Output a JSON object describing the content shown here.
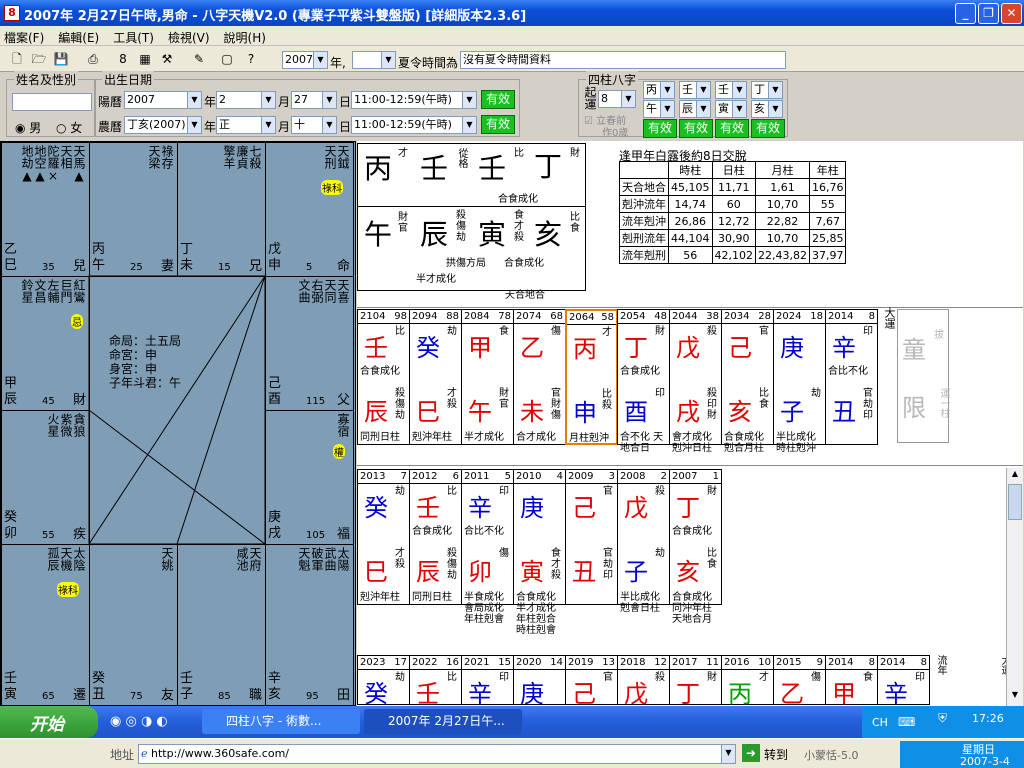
{
  "window": {
    "title": "2007年 2月27日午時,男命 - 八字天機V2.0 (專業子平紫斗雙盤版) [詳細版本2.3.6]"
  },
  "menu": [
    "檔案(F)",
    "編輯(E)",
    "工具(T)",
    "檢視(V)",
    "說明(H)"
  ],
  "toolbar": {
    "year": "2007",
    "year_unit": "年,",
    "dst_label": "夏令時間為",
    "dst_value": "沒有夏令時間資料"
  },
  "form": {
    "name_group": "姓名及性別",
    "birth_group": "出生日期",
    "male": "男",
    "female": "女",
    "solar_label": "陽曆",
    "solar_year": "2007",
    "solar_month": "2",
    "solar_day": "27",
    "solar_time": "11:00-12:59(午時)",
    "lunar_label": "農曆",
    "lunar_year": "丁亥(2007)",
    "lunar_month": "正",
    "lunar_day": "十",
    "lunar_time": "11:00-12:59(午時)",
    "valid": "有效",
    "year_u": "年",
    "month_u": "月",
    "day_u": "日"
  },
  "pillars_form": {
    "title": "四柱八字",
    "qiyun": "起運",
    "qiyun_val": "8",
    "sel": [
      [
        "丙",
        "壬",
        "壬",
        "丁"
      ],
      [
        "午",
        "辰",
        "寅",
        "亥"
      ]
    ],
    "valid": "有效",
    "lichun": "立春前",
    "zuo": "作0歲"
  },
  "ziwei": {
    "palaces": [
      {
        "stars": [
          "天馬▲",
          "天相",
          "陀羅×",
          "地空▲",
          "地劫▲"
        ],
        "gz": "乙巳",
        "num": "35",
        "name": "兒"
      },
      {
        "stars": [
          "祿存",
          "天梁"
        ],
        "gz": "丙午",
        "num": "25",
        "name": "妻"
      },
      {
        "stars": [
          "七殺",
          "廉貞",
          "擎羊"
        ],
        "gz": "丁未",
        "num": "15",
        "name": "兄"
      },
      {
        "stars": [
          "天鉞",
          "天刑"
        ],
        "gz": "戊申",
        "num": "5",
        "name": "命"
      },
      {
        "stars": [
          "紅鸞",
          "巨門",
          "左輔",
          "文昌",
          "鈴星"
        ],
        "gz": "甲辰",
        "num": "45",
        "name": "財"
      },
      {
        "stars": [
          "天喜",
          "天同",
          "右弼",
          "文曲"
        ],
        "gz": "己酉",
        "num": "115",
        "name": "父"
      },
      {
        "stars": [
          "貪狼",
          "紫微",
          "火星"
        ],
        "gz": "癸卯",
        "num": "55",
        "name": "疾"
      },
      {
        "stars": [
          "寡宿"
        ],
        "gz": "庚戌",
        "num": "105",
        "name": "福"
      },
      {
        "stars": [
          "太陰",
          "天機",
          "孤辰"
        ],
        "gz": "壬寅",
        "num": "65",
        "name": "遷"
      },
      {
        "stars": [
          "天姚"
        ],
        "gz": "癸丑",
        "num": "75",
        "name": "友"
      },
      {
        "stars": [
          "天府",
          "咸池"
        ],
        "gz": "壬子",
        "num": "85",
        "name": "職"
      },
      {
        "stars": [
          "太陽",
          "武曲",
          "破軍",
          "天魁"
        ],
        "gz": "辛亥",
        "num": "95",
        "name": "田"
      }
    ],
    "center": [
      "命局：土五局",
      "命宮：申",
      "身宮：申",
      "子年斗君：午"
    ],
    "badges": {
      "lu": "祿科",
      "ji": "忌",
      "ke": "權",
      "lu2": "祿科"
    }
  },
  "bazi": {
    "stems": [
      "丙",
      "壬",
      "壬",
      "丁"
    ],
    "branches": [
      "午",
      "辰",
      "寅",
      "亥"
    ],
    "stem_tags": [
      "才",
      "從格",
      "比",
      "財"
    ],
    "branch_tags": [
      "財官",
      "殺傷劫",
      "食才殺",
      "比食"
    ],
    "notes": [
      "合食成化",
      "拱傷方局",
      "合食成化",
      "半才成化",
      "天合地合"
    ],
    "yun_note": "逢甲年白露後約8日交脫",
    "table": {
      "head": [
        "",
        "時柱",
        "日柱",
        "月柱",
        "年柱"
      ],
      "rows": [
        [
          "天合地合",
          "45,105",
          "11,71",
          "1,61",
          "16,76"
        ],
        [
          "剋沖流年",
          "14,74",
          "60",
          "10,70",
          "55"
        ],
        [
          "流年剋沖",
          "26,86",
          "12,72",
          "22,82",
          "7,67"
        ],
        [
          "剋刑流年",
          "44,104",
          "30,90",
          "10,70",
          "25,85"
        ],
        [
          "流年剋刑",
          "56",
          "42,102",
          "22,43,82",
          "37,97"
        ]
      ]
    }
  },
  "dayun": [
    {
      "y": "2104",
      "a": "98",
      "s": "壬",
      "st": "比",
      "b": "辰",
      "bt": "殺傷劫",
      "n1": "合食成化",
      "n2": "同刑日柱",
      "sc": "red",
      "bc": "red"
    },
    {
      "y": "2094",
      "a": "88",
      "s": "癸",
      "st": "劫",
      "b": "巳",
      "bt": "才殺",
      "n1": "",
      "n2": "剋沖年柱",
      "sc": "blue",
      "bc": "red"
    },
    {
      "y": "2084",
      "a": "78",
      "s": "甲",
      "st": "食",
      "b": "午",
      "bt": "財官",
      "n1": "",
      "n2": "半才成化",
      "sc": "red",
      "bc": "red"
    },
    {
      "y": "2074",
      "a": "68",
      "s": "乙",
      "st": "傷",
      "b": "未",
      "bt": "官財傷",
      "n1": "",
      "n2": "合才成化",
      "sc": "red",
      "bc": "red"
    },
    {
      "y": "2064",
      "a": "58",
      "s": "丙",
      "st": "才",
      "b": "申",
      "bt": "比殺",
      "n1": "",
      "n2": "月柱剋沖",
      "sc": "red",
      "bc": "blue"
    },
    {
      "y": "2054",
      "a": "48",
      "s": "丁",
      "st": "財",
      "b": "酉",
      "bt": "印",
      "n1": "合食成化",
      "n2": "合不化 天地合日",
      "sc": "red",
      "bc": "blue"
    },
    {
      "y": "2044",
      "a": "38",
      "s": "戊",
      "st": "殺",
      "b": "戌",
      "bt": "殺印財",
      "n1": "",
      "n2": "會才成化 剋沖日柱",
      "sc": "red",
      "bc": "red"
    },
    {
      "y": "2034",
      "a": "28",
      "s": "己",
      "st": "官",
      "b": "亥",
      "bt": "比食",
      "n1": "",
      "n2": "合食成化 剋合月柱",
      "sc": "red",
      "bc": "red"
    },
    {
      "y": "2024",
      "a": "18",
      "s": "庚",
      "st": "",
      "b": "子",
      "bt": "劫",
      "n1": "",
      "n2": "半比成化 時柱剋沖",
      "sc": "blue",
      "bc": "blue"
    },
    {
      "y": "2014",
      "a": "8",
      "s": "辛",
      "st": "印",
      "b": "丑",
      "bt": "官劫印",
      "n1": "合比不化",
      "n2": "",
      "sc": "blue",
      "bc": "blue"
    }
  ],
  "dayun_extra": {
    "label": "大運",
    "tong": "童",
    "xian": "限",
    "tag1": "拔",
    "tag2": "運一柱"
  },
  "liunian": [
    {
      "y": "2013",
      "a": "7",
      "s": "癸",
      "st": "劫",
      "b": "巳",
      "bt": "才殺",
      "n1": "",
      "n2": "剋沖年柱",
      "sc": "blue",
      "bc": "red"
    },
    {
      "y": "2012",
      "a": "6",
      "s": "壬",
      "st": "比",
      "b": "辰",
      "bt": "殺傷劫",
      "n1": "合食成化",
      "n2": "同刑日柱",
      "sc": "red",
      "bc": "red"
    },
    {
      "y": "2011",
      "a": "5",
      "s": "辛",
      "st": "印",
      "b": "卯",
      "bt": "傷",
      "n1": "合比不化",
      "n2": "半食成化 會局成化 年柱剋會",
      "sc": "blue",
      "bc": "red"
    },
    {
      "y": "2010",
      "a": "4",
      "s": "庚",
      "st": "",
      "b": "寅",
      "bt": "食才殺",
      "n1": "",
      "n2": "合食成化 半才成化 年柱剋合 時柱剋會",
      "sc": "blue",
      "bc": "red"
    },
    {
      "y": "2009",
      "a": "3",
      "s": "己",
      "st": "官",
      "b": "丑",
      "bt": "官劫印",
      "n1": "",
      "n2": "",
      "sc": "red",
      "bc": "red"
    },
    {
      "y": "2008",
      "a": "2",
      "s": "戊",
      "st": "殺",
      "b": "子",
      "bt": "劫",
      "n1": "",
      "n2": "半比成化 剋會日柱",
      "sc": "red",
      "bc": "blue"
    },
    {
      "y": "2007",
      "a": "1",
      "s": "丁",
      "st": "財",
      "b": "亥",
      "bt": "比食",
      "n1": "合食成化",
      "n2": "合食成化 同沖年柱 天地合月",
      "sc": "red",
      "bc": "red"
    }
  ],
  "liunian2": [
    {
      "y": "2023",
      "a": "17",
      "s": "癸",
      "st": "劫",
      "sc": "blue"
    },
    {
      "y": "2022",
      "a": "16",
      "s": "壬",
      "st": "比",
      "sc": "red"
    },
    {
      "y": "2021",
      "a": "15",
      "s": "辛",
      "st": "印",
      "sc": "blue"
    },
    {
      "y": "2020",
      "a": "14",
      "s": "庚",
      "st": "",
      "sc": "blue"
    },
    {
      "y": "2019",
      "a": "13",
      "s": "己",
      "st": "官",
      "sc": "red"
    },
    {
      "y": "2018",
      "a": "12",
      "s": "戊",
      "st": "殺",
      "sc": "red"
    },
    {
      "y": "2017",
      "a": "11",
      "s": "丁",
      "st": "財",
      "sc": "red"
    },
    {
      "y": "2016",
      "a": "10",
      "s": "丙",
      "st": "才",
      "sc": "green"
    },
    {
      "y": "2015",
      "a": "9",
      "s": "乙",
      "st": "傷",
      "sc": "red"
    },
    {
      "y": "2014",
      "a": "8",
      "s": "甲",
      "st": "食",
      "sc": "red"
    },
    {
      "y": "2014",
      "a": "8",
      "s": "辛",
      "st": "印",
      "sc": "blue"
    }
  ],
  "liunian2_tags": {
    "liu": "流年",
    "da": "大運"
  },
  "taskbar": {
    "start": "开始",
    "task1": "四柱八字 - 術數...",
    "task2": "2007年 2月27日午...",
    "ime": "CH",
    "time": "17:26",
    "weekday": "星期日",
    "date": "2007-3-4"
  },
  "address": {
    "label": "地址",
    "url": "http://www.360safe.com/",
    "go": "转到",
    "user": "小蒙恬-5.0"
  }
}
